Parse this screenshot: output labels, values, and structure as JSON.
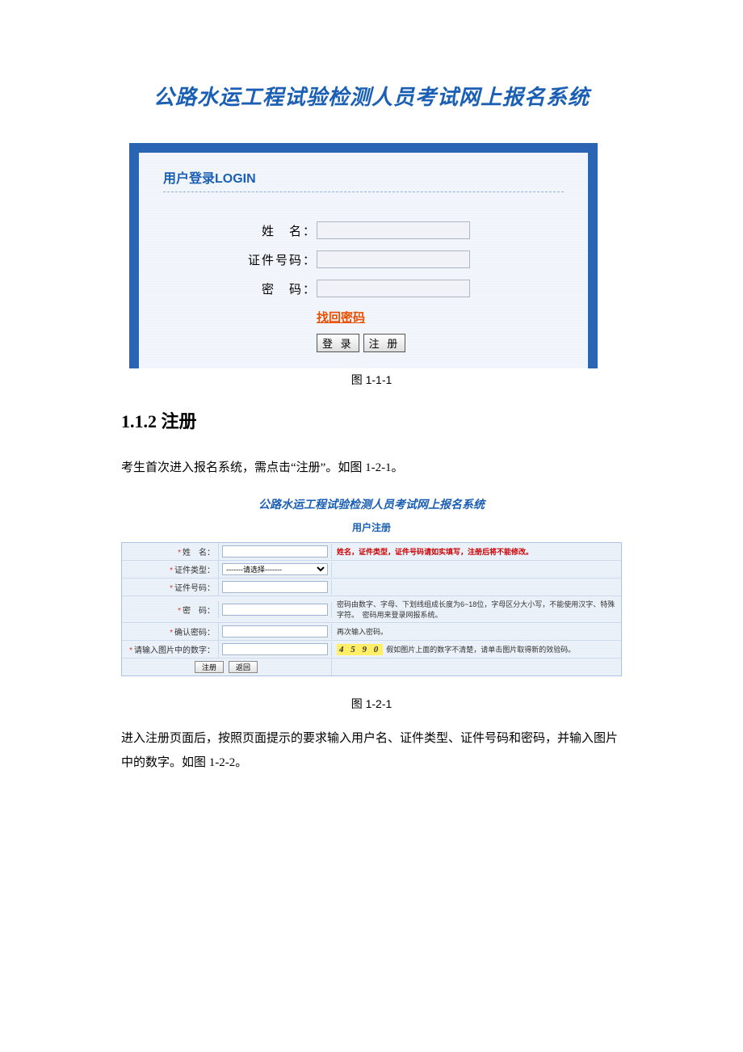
{
  "mainTitle": "公路水运工程试验检测人员考试网上报名系统",
  "loginPanel": {
    "heading": "用户登录LOGIN",
    "nameLabel": "姓　名：",
    "idLabel": "证件号码：",
    "pwLabel": "密　码：",
    "forgotLink": "找回密码",
    "loginBtn": "登 录",
    "registerBtn": "注 册"
  },
  "figCaption1": "图 1-1-1",
  "sectionHeading": "1.1.2 注册",
  "bodyText1": "考生首次进入报名系统，需点击“注册”。如图 1-2-1。",
  "regSection": {
    "title": "公路水运工程试验检测人员考试网上报名系统",
    "subtitle": "用户注册",
    "rows": {
      "name": {
        "label": "姓　名："
      },
      "idType": {
        "label": "证件类型：",
        "select": "-------请选择-------"
      },
      "idNo": {
        "label": "证件号码："
      },
      "pw": {
        "label": "密　码："
      },
      "pwConfirm": {
        "label": "确认密码："
      },
      "captcha": {
        "label": "请输入图片中的数字："
      }
    },
    "hints": {
      "row1": "姓名，证件类型，证件号码请如实填写，注册后将不能修改。",
      "pw": "密码由数字、字母、下划线组成长度为6~18位，字母区分大小写，不能使用汉字、特殊字符。　密码用来登录网报系统。",
      "pwConfirm": "再次输入密码。",
      "captcha": "假如图片上面的数字不清楚，请单击图片取得新的效验码。"
    },
    "captchaValue": "4 5 9 0",
    "regBtn": "注册",
    "backBtn": "返回"
  },
  "figCaption2": "图 1-2-1",
  "bodyText2": "进入注册页面后，按照页面提示的要求输入用户名、证件类型、证件号码和密码，并输入图片中的数字。如图 1-2-2。"
}
